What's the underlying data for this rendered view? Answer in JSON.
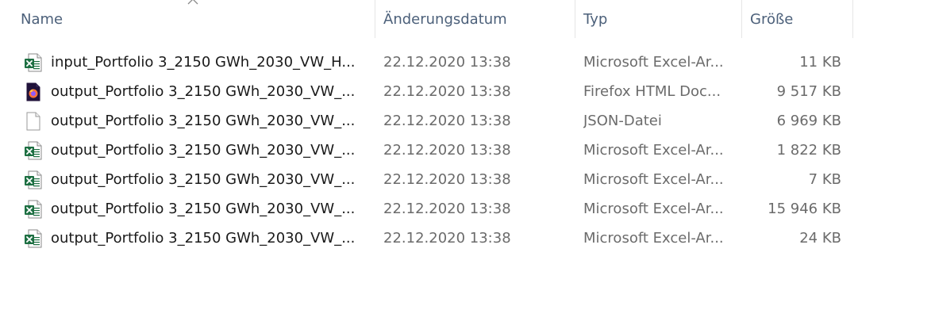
{
  "columns": {
    "name": "Name",
    "modified": "Änderungsdatum",
    "type": "Typ",
    "size": "Größe"
  },
  "files": [
    {
      "name": "input_Portfolio 3_2150 GWh_2030_VW_H...",
      "modified": "22.12.2020 13:38",
      "type": "Microsoft Excel-Ar...",
      "size": "11 KB",
      "icon": "excel-file-icon"
    },
    {
      "name": "output_Portfolio 3_2150 GWh_2030_VW_...",
      "modified": "22.12.2020 13:38",
      "type": "Firefox HTML Doc...",
      "size": "9 517 KB",
      "icon": "firefox-html-icon"
    },
    {
      "name": "output_Portfolio 3_2150 GWh_2030_VW_...",
      "modified": "22.12.2020 13:38",
      "type": "JSON-Datei",
      "size": "6 969 KB",
      "icon": "blank-file-icon"
    },
    {
      "name": "output_Portfolio 3_2150 GWh_2030_VW_...",
      "modified": "22.12.2020 13:38",
      "type": "Microsoft Excel-Ar...",
      "size": "1 822 KB",
      "icon": "excel-file-icon"
    },
    {
      "name": "output_Portfolio 3_2150 GWh_2030_VW_...",
      "modified": "22.12.2020 13:38",
      "type": "Microsoft Excel-Ar...",
      "size": "7 KB",
      "icon": "excel-file-icon"
    },
    {
      "name": "output_Portfolio 3_2150 GWh_2030_VW_...",
      "modified": "22.12.2020 13:38",
      "type": "Microsoft Excel-Ar...",
      "size": "15 946 KB",
      "icon": "excel-file-icon"
    },
    {
      "name": "output_Portfolio 3_2150 GWh_2030_VW_...",
      "modified": "22.12.2020 13:38",
      "type": "Microsoft Excel-Ar...",
      "size": "24 KB",
      "icon": "excel-file-icon"
    }
  ],
  "sort": {
    "column": "name",
    "direction": "ascending"
  },
  "colors": {
    "header_text": "#4c607a",
    "name_text": "#1a1a1a",
    "meta_text": "#6b6b6b",
    "excel_green": "#1d6f42"
  }
}
